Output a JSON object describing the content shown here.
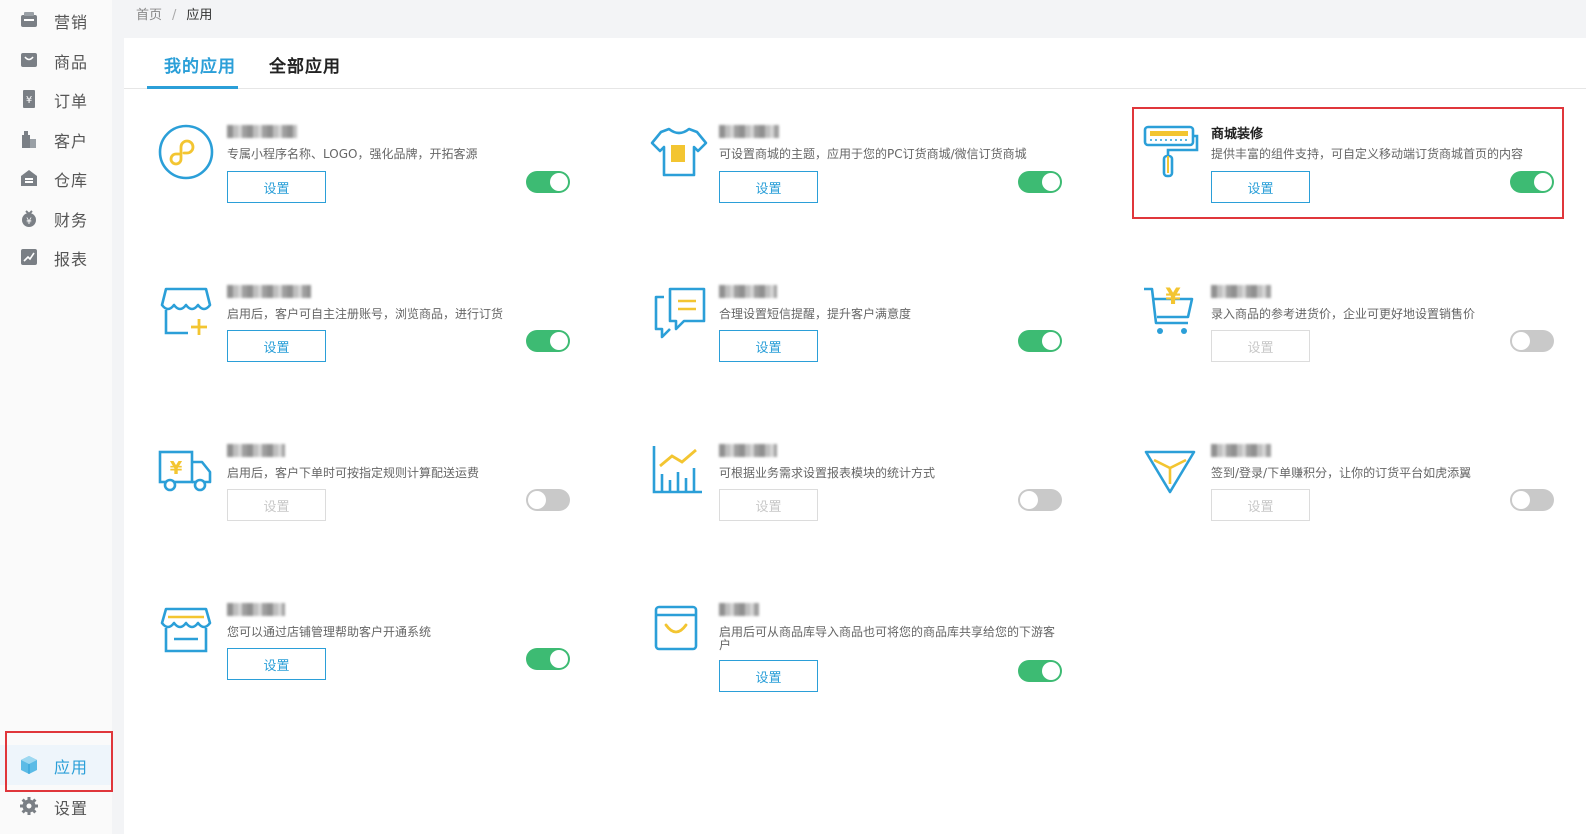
{
  "sidebar": {
    "items": [
      {
        "label": "营销",
        "icon": "marketing-icon"
      },
      {
        "label": "商品",
        "icon": "goods-icon"
      },
      {
        "label": "订单",
        "icon": "order-icon"
      },
      {
        "label": "客户",
        "icon": "customer-icon"
      },
      {
        "label": "仓库",
        "icon": "warehouse-icon"
      },
      {
        "label": "财务",
        "icon": "finance-icon"
      },
      {
        "label": "报表",
        "icon": "report-icon"
      }
    ],
    "bottom_items": [
      {
        "label": "应用",
        "icon": "cube-icon",
        "active": true
      },
      {
        "label": "设置",
        "icon": "gear-icon"
      }
    ]
  },
  "breadcrumb": {
    "home": "首页",
    "separator": "/",
    "current": "应用"
  },
  "tabs": [
    {
      "label": "我的应用",
      "active": true
    },
    {
      "label": "全部应用",
      "active": false
    }
  ],
  "colors": {
    "accent": "#2b9fd8",
    "toggle_on": "#3dbb73",
    "toggle_off": "#c9c9c9",
    "highlight": "#e0363b",
    "icon_yellow": "#f3c531"
  },
  "apps": [
    {
      "title": "",
      "title_obscured": true,
      "icon": "mini-program-icon",
      "desc": "专属小程序名称、LOGO，强化品牌，开拓客源",
      "button": "设置",
      "button_enabled": true,
      "enabled": true
    },
    {
      "title": "",
      "title_obscured": true,
      "icon": "tshirt-icon",
      "desc": "可设置商城的主题，应用于您的PC订货商城/微信订货商城",
      "button": "设置",
      "button_enabled": true,
      "enabled": true
    },
    {
      "title": "商城装修",
      "title_obscured": false,
      "icon": "paint-roller-icon",
      "desc": "提供丰富的组件支持，可自定义移动端订货商城首页的内容",
      "button": "设置",
      "button_enabled": true,
      "enabled": true,
      "highlighted": true
    },
    {
      "title": "",
      "title_obscured": true,
      "icon": "shop-add-icon",
      "desc": "启用后，客户可自主注册账号，浏览商品，进行订货",
      "button": "设置",
      "button_enabled": true,
      "enabled": true
    },
    {
      "title": "",
      "title_obscured": true,
      "icon": "sms-icon",
      "desc": "合理设置短信提醒，提升客户满意度",
      "button": "设置",
      "button_enabled": true,
      "enabled": true
    },
    {
      "title": "",
      "title_obscured": true,
      "icon": "cart-yen-icon",
      "desc": "录入商品的参考进货价，企业可更好地设置销售价",
      "button": "设置",
      "button_enabled": false,
      "enabled": false
    },
    {
      "title": "",
      "title_obscured": true,
      "icon": "delivery-truck-icon",
      "desc": "启用后，客户下单时可按指定规则计算配送运费",
      "button": "设置",
      "button_enabled": false,
      "enabled": false
    },
    {
      "title": "",
      "title_obscured": true,
      "icon": "chart-icon",
      "desc": "可根据业务需求设置报表模块的统计方式",
      "button": "设置",
      "button_enabled": false,
      "enabled": false
    },
    {
      "title": "",
      "title_obscured": true,
      "icon": "diamond-icon",
      "desc": "签到/登录/下单赚积分，让你的订货平台如虎添翼",
      "button": "设置",
      "button_enabled": false,
      "enabled": false
    },
    {
      "title": "",
      "title_obscured": true,
      "icon": "store-icon",
      "desc": "您可以通过店铺管理帮助客户开通系统",
      "button": "设置",
      "button_enabled": true,
      "enabled": true
    },
    {
      "title": "",
      "title_obscured": true,
      "icon": "shopping-bag-icon",
      "desc": "启用后可从商品库导入商品也可将您的商品库共享给您的下游客户",
      "button": "设置",
      "button_enabled": true,
      "enabled": true
    }
  ]
}
